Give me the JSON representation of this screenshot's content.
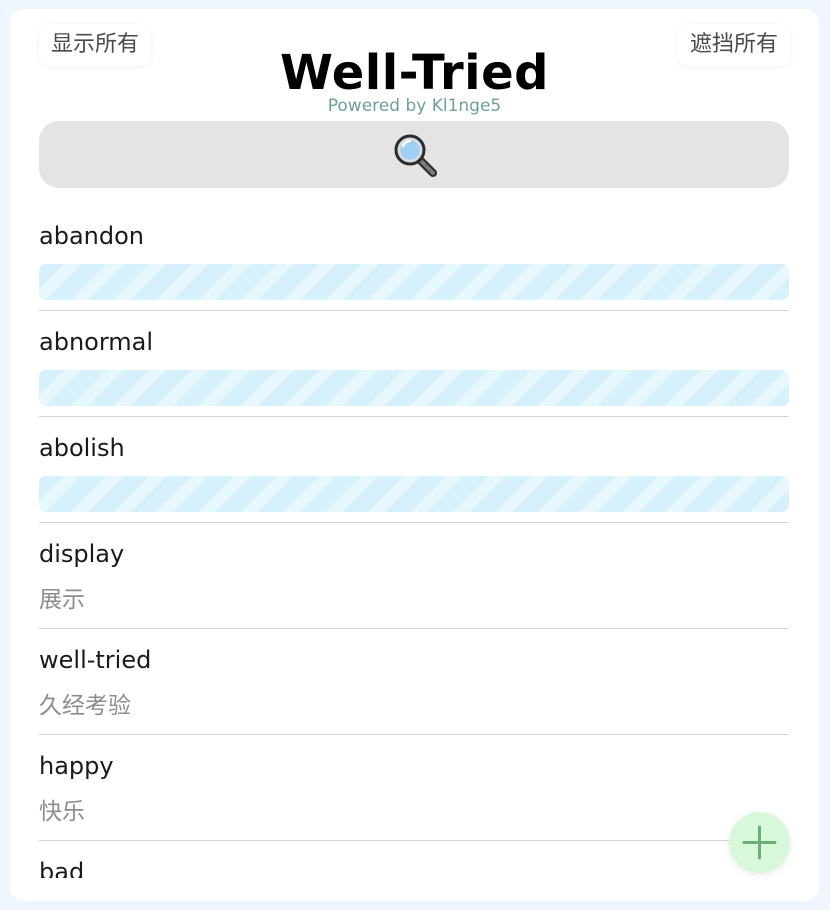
{
  "header": {
    "show_all_label": "显示所有",
    "hide_all_label": "遮挡所有",
    "title": "Well-Tried",
    "subtitle": "Powered by Kl1nge5"
  },
  "search": {
    "icon": "magnifier-icon"
  },
  "words": [
    {
      "en": "abandon",
      "zh": "",
      "masked": true
    },
    {
      "en": "abnormal",
      "zh": "",
      "masked": true
    },
    {
      "en": "abolish",
      "zh": "",
      "masked": true
    },
    {
      "en": "display",
      "zh": "展示",
      "masked": false
    },
    {
      "en": "well-tried",
      "zh": "久经考验",
      "masked": false
    },
    {
      "en": "happy",
      "zh": "快乐",
      "masked": false
    },
    {
      "en": "bad",
      "zh": "",
      "masked": false
    }
  ],
  "add_button": {
    "icon": "plus-icon"
  },
  "colors": {
    "page_background": "#f0f6fd",
    "card_background": "#ffffff",
    "search_background": "#e4e4e4",
    "mask_stripe_a": "#d6f1fc",
    "mask_stripe_b": "#e6f7fd",
    "fab_background": "#d8f8dc",
    "fab_plus": "#6cae75",
    "subtitle": "#6f9f9a"
  }
}
